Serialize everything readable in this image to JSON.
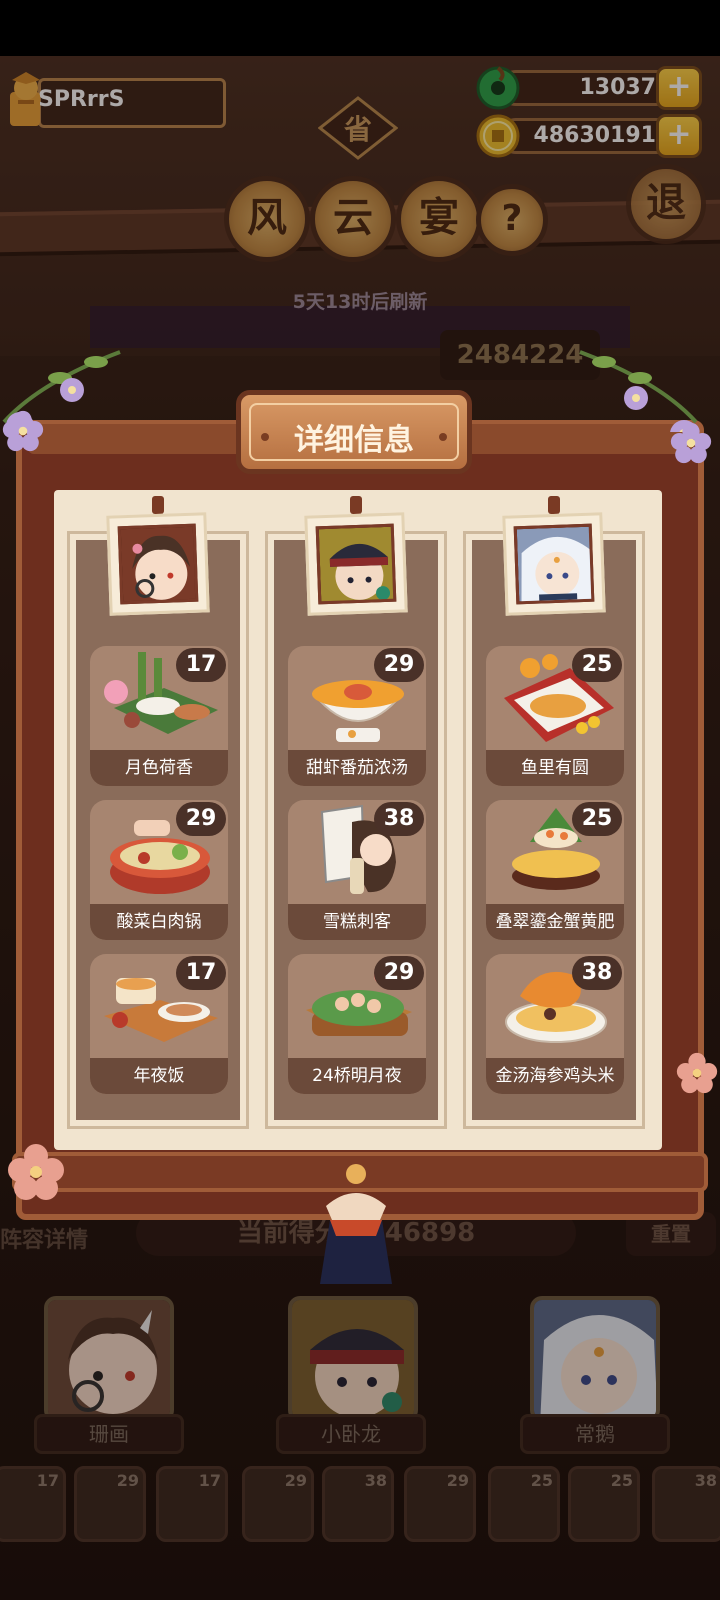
{
  "player": {
    "name": "SPRrrS"
  },
  "currency": {
    "jade": "13037",
    "coins": "48630191",
    "plus": "+"
  },
  "banner": {
    "province": "省",
    "title_chars": [
      "风",
      "云",
      "宴"
    ],
    "help": "?",
    "exit": "退",
    "refresh": "5天13时后刷新",
    "score_partial": "2484224"
  },
  "modal": {
    "title": "详细信息",
    "columns": [
      {
        "hero": "珊画",
        "dishes": [
          {
            "name": "月色荷香",
            "level": "17"
          },
          {
            "name": "酸菜白肉锅",
            "level": "29"
          },
          {
            "name": "年夜饭",
            "level": "17"
          }
        ]
      },
      {
        "hero": "小卧龙",
        "dishes": [
          {
            "name": "甜虾番茄浓汤",
            "level": "29"
          },
          {
            "name": "雪糕刺客",
            "level": "38"
          },
          {
            "name": "24桥明月夜",
            "level": "29"
          }
        ]
      },
      {
        "hero": "常鹅",
        "dishes": [
          {
            "name": "鱼里有圆",
            "level": "25"
          },
          {
            "name": "叠翠鎏金蟹黄肥",
            "level": "25"
          },
          {
            "name": "金汤海参鸡头米",
            "level": "38"
          }
        ]
      }
    ]
  },
  "bottom": {
    "lineup_label": "阵容详情",
    "current_score": "当前得分：246898",
    "reset_label": "重置",
    "heroes": [
      "珊画",
      "小卧龙",
      "常鹅"
    ],
    "slots": [
      "17",
      "29",
      "17",
      "29",
      "38",
      "29",
      "25",
      "25",
      "38"
    ]
  },
  "colors": {
    "frame": "#6d2e1e",
    "paper": "#f1e4cf",
    "column": "#8a6c5a",
    "badge": "#4a3128"
  }
}
